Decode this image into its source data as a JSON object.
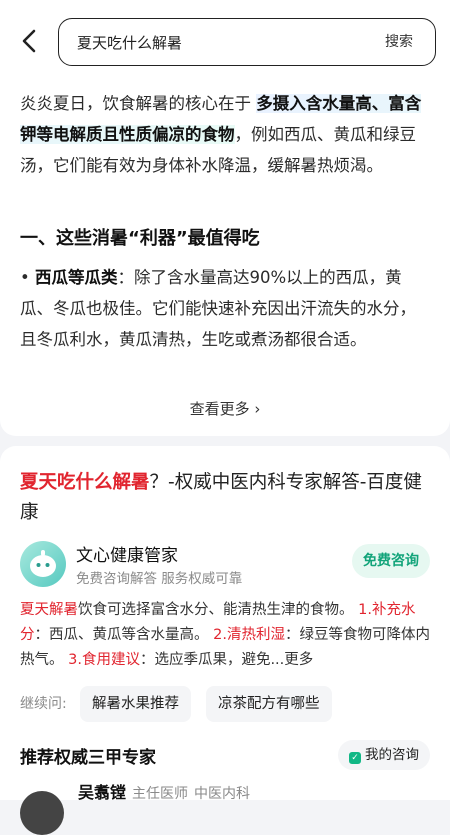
{
  "search": {
    "query": "夏天吃什么解暑",
    "button": "搜索"
  },
  "ai_summary": {
    "intro_pre": "炎炎夏日，饮食解暑的核心在于 ",
    "intro_highlight": "多摄入含水量高、富含钾等电解质且性质偏凉的食物",
    "intro_post": "，例如西瓜、黄瓜和绿豆汤，它们能有效为身体补水降温，缓解暑热烦渴。",
    "heading": "一、这些消暑“利器”最值得吃",
    "bullet_label": "西瓜等瓜类",
    "bullet_text": "：除了含水量高达90%以上的西瓜，黄瓜、冬瓜也极佳。它们能快速补充因出汗流失的水分，且冬瓜利水，黄瓜清热，生吃或煮汤都很合适。",
    "more": "查看更多"
  },
  "result": {
    "title_red": "夏天吃什么解暑",
    "title_rest": "？-权威中医内科专家解答-百度健康",
    "account_name": "文心健康管家",
    "account_sub": "免费咨询解答 服务权威可靠",
    "consult_button": "免费咨询",
    "answer": {
      "p1_red": "夏天解暑",
      "p1": "饮食可选择富含水分、能清热生津的食物。",
      "n1": "1.",
      "k1": "补充水分",
      "t1": "：西瓜、黄瓜等含水量高。",
      "n2": "2.",
      "k2": "清热利湿",
      "t2": "：绿豆等食物可降体内热气。",
      "n3": "3.",
      "k3": "食用建议",
      "t3": "：选应季瓜果，避免",
      "more": "...更多"
    },
    "follow_label": "继续问:",
    "chips": [
      "解暑水果推荐",
      "凉茶配方有哪些"
    ],
    "recommend_title": "推荐权威三甲专家",
    "my_consult": "我的咨询",
    "doctor": {
      "name": "吴翥镗",
      "title": "主任医师",
      "dept": "中医内科"
    }
  }
}
